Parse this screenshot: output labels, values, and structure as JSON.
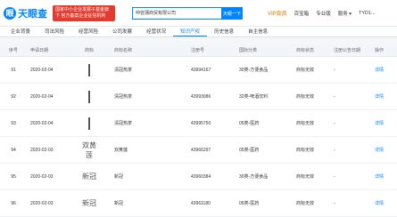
{
  "brand": {
    "name": "天眼查",
    "logo_glyph": "眼",
    "color": "#0084ff"
  },
  "promo": {
    "text": "国家中小企业发展子基金旗下 官方备案企业征信机构"
  },
  "search": {
    "value": "仲容蒲商贸有限公司",
    "button": "天眼一下"
  },
  "nav": {
    "vip": "VIP会员",
    "items": [
      "百宝箱",
      "专业版",
      "服务 ▾",
      "TYD1..."
    ]
  },
  "tabs": [
    {
      "label": "企业背景",
      "active": false
    },
    {
      "label": "司法风险",
      "active": false
    },
    {
      "label": "经营风险",
      "active": false
    },
    {
      "label": "公司发展",
      "active": false
    },
    {
      "label": "经营状况",
      "active": false
    },
    {
      "label": "知识产权",
      "active": true
    },
    {
      "label": "历史信息",
      "active": false
    },
    {
      "label": "自主信息",
      "active": false
    }
  ],
  "table": {
    "headers": [
      "序号",
      "申请日期",
      "商标",
      "商标名称",
      "注册号",
      "国际分类",
      "商标状态",
      "注册公告日期",
      "操作"
    ],
    "rows": [
      {
        "no": "91",
        "date": "2020-02-04",
        "mark": "vert",
        "name": "清冠热茶",
        "reg": "43994167",
        "cls": "30类-方便食品",
        "status": "商标无效",
        "pub": "-",
        "op": "详情"
      },
      {
        "no": "92",
        "date": "2020-02-04",
        "mark": "vert",
        "name": "清冠热茶",
        "reg": "43993086",
        "cls": "32类-啤酒饮料",
        "status": "商标无效",
        "pub": "-",
        "op": "详情"
      },
      {
        "no": "93",
        "date": "2020-02-04",
        "mark": "vert",
        "name": "清冠热茶",
        "reg": "43995750",
        "cls": "05类-医药",
        "status": "商标无效",
        "pub": "-",
        "op": "详情"
      },
      {
        "no": "94",
        "date": "2020-02-03",
        "mark": "双黄莲",
        "name": "双黄莲",
        "reg": "43966297",
        "cls": "05类-医药",
        "status": "商标无效",
        "pub": "-",
        "op": "详情"
      },
      {
        "no": "95",
        "date": "2020-02-03",
        "mark": "新冠",
        "name": "新冠",
        "reg": "43960384",
        "cls": "30类-方便食品",
        "status": "商标无效",
        "pub": "-",
        "op": "详情"
      },
      {
        "no": "96",
        "date": "2020-02-03",
        "mark": "新冠",
        "name": "新冠",
        "reg": "43961180",
        "cls": "05类-医药",
        "status": "商标无效",
        "pub": "-",
        "op": "详情"
      }
    ]
  }
}
